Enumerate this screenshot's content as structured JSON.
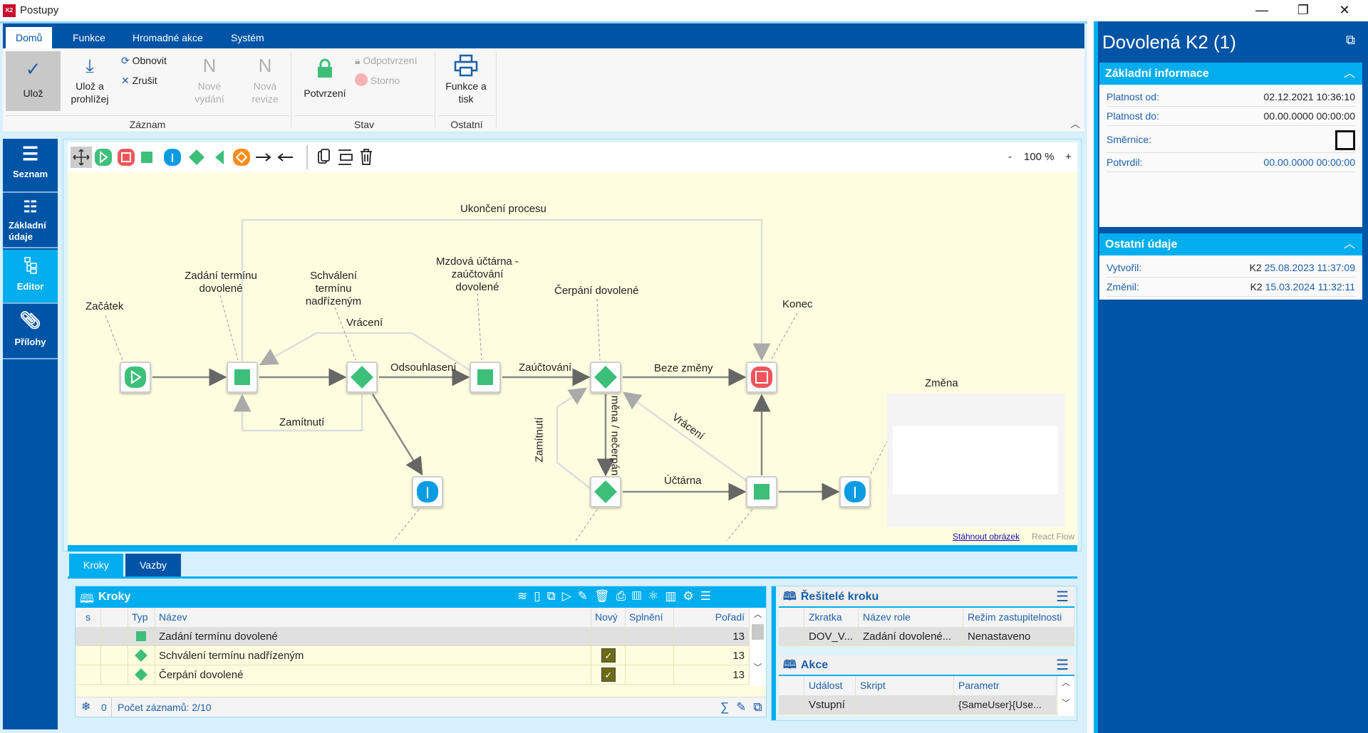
{
  "window": {
    "title": "Postupy",
    "minimize": "—",
    "restore": "❐",
    "close": "✕"
  },
  "ribbon": {
    "tabs": [
      "Domů",
      "Funkce",
      "Hromadné akce",
      "Systém"
    ],
    "save": "Ulož",
    "save_view_1": "Ulož a",
    "save_view_2": "prohlížej",
    "refresh": "Obnovit",
    "cancel": "Zrušit",
    "new_release_1": "Nové",
    "new_release_2": "vydání",
    "new_revision_1": "Nová",
    "new_revision_2": "revize",
    "confirm": "Potvrzení",
    "unconfirm": "Odpotvrzení",
    "storno": "Storno",
    "print_1": "Funkce a",
    "print_2": "tisk",
    "groups": [
      "Záznam",
      "Stav",
      "Ostatní"
    ]
  },
  "sidebar": {
    "items": [
      {
        "label": "Seznam"
      },
      {
        "label": "Základní údaje"
      },
      {
        "label": "Editor",
        "active": true
      },
      {
        "label": "Přílohy"
      }
    ]
  },
  "editor": {
    "zoom_minus": "-",
    "zoom": "100 %",
    "zoom_plus": "+",
    "download": "Stáhnout obrázek",
    "attribution": "React Flow",
    "nodes": {
      "start": "Začátek",
      "zadani_1": "Zadání termínu",
      "zadani_2": "dovolené",
      "schvaleni_1": "Schválení",
      "schvaleni_2": "termínu",
      "schvaleni_3": "nadřízeným",
      "mzdova_1": "Mzdová účtárna -",
      "mzdova_2": "zaúčtování",
      "mzdova_3": "dovolené",
      "cerpani": "Čerpání dovolené",
      "konec": "Konec",
      "zmena": "Změna"
    },
    "edges": {
      "ukonceni": "Ukončení procesu",
      "vraceni1": "Vrácení",
      "odsouhlaseni": "Odsouhlasení",
      "zauctovani": "Zaúčtování",
      "beze_zmeny": "Beze změny",
      "zamitnuti1": "Zamítnutí",
      "zamitnuti2": "Zamítnutí",
      "nezmena": "měna / nečerpán",
      "vraceni2": "Vrácení",
      "uctarna": "Účtárna"
    },
    "colors": {
      "green": "#3dbf7a",
      "red": "#f0555a",
      "blue": "#0a9be3",
      "orange": "#fb8c1a",
      "canvas": "#fffde0"
    }
  },
  "bottom_tabs": [
    "Kroky",
    "Vazby"
  ],
  "steps": {
    "title": "Kroky",
    "columns": [
      "s",
      "",
      "Typ",
      "Název",
      "Nový",
      "Splnění",
      "Pořadí"
    ],
    "rows": [
      {
        "type": "square",
        "name": "Zadání termínu dovolené",
        "new": false,
        "order": "13"
      },
      {
        "type": "diamond",
        "name": "Schválení termínu nadřízeným",
        "new": true,
        "order": "13"
      },
      {
        "type": "diamond",
        "name": "Čerpání dovolené",
        "new": true,
        "order": "13"
      }
    ],
    "footer_count": "0",
    "footer_records": "Počet záznamů: 2/10"
  },
  "solvers": {
    "title": "Řešitelé kroku",
    "columns": [
      "Zkratka",
      "Název role",
      "Režim zastupitelnosti"
    ],
    "rows": [
      [
        "DOV_V...",
        "Zadání dovolené...",
        "Nenastaveno"
      ]
    ]
  },
  "actions": {
    "title": "Akce",
    "columns": [
      "Událost",
      "Skript",
      "Parametr"
    ],
    "rows": [
      [
        "Vstupní",
        "",
        "{SameUser}{Use..."
      ]
    ]
  },
  "detail": {
    "title": "Dovolená K2 (1)",
    "basic": {
      "title": "Základní informace",
      "valid_from_label": "Platnost od:",
      "valid_from": "02.12.2021 10:36:10",
      "valid_to_label": "Platnost do:",
      "valid_to": "00.00.0000 00:00:00",
      "directive_label": "Směrnice:",
      "directive": false,
      "confirmed_label": "Potvrdil:",
      "confirmed": "00.00.0000 00:00:00"
    },
    "other": {
      "title": "Ostatní údaje",
      "created_label": "Vytvořil:",
      "created_user": "K2",
      "created": "25.08.2023 11:37:09",
      "changed_label": "Změnil:",
      "changed_user": "K2",
      "changed": "15.03.2024 11:32:11"
    }
  }
}
